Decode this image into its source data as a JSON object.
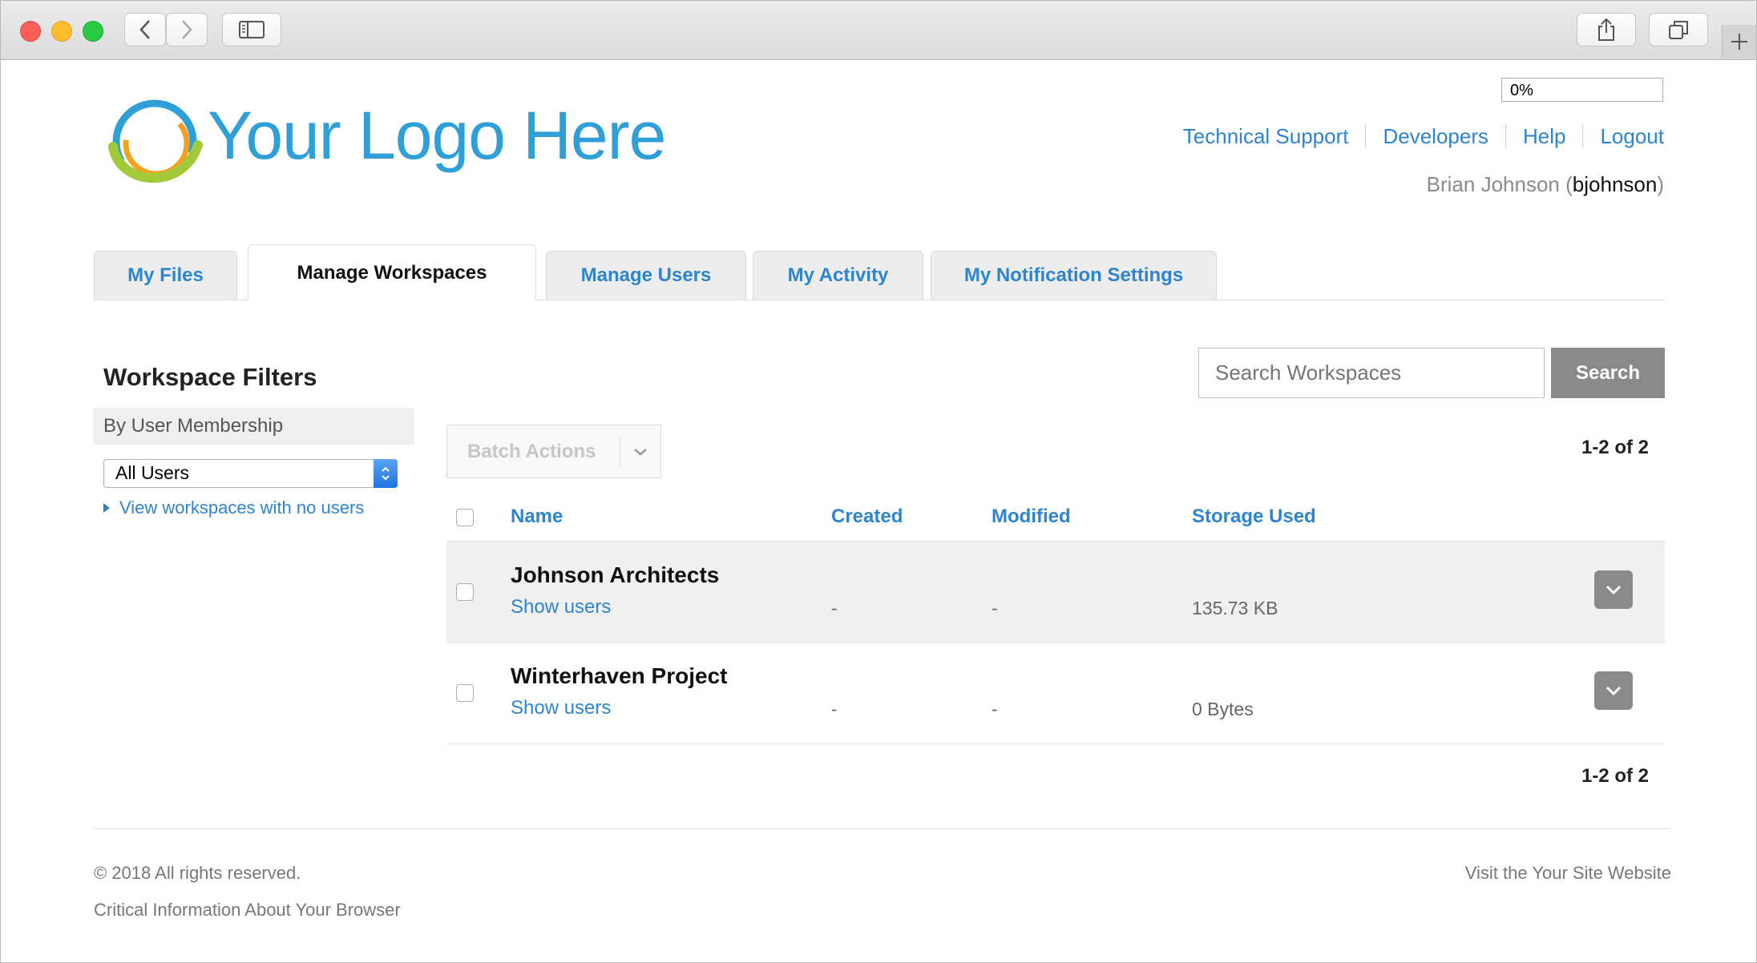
{
  "progress": {
    "text": "0%"
  },
  "logo": {
    "text": "Your Logo Here"
  },
  "header": {
    "links": [
      "Technical Support",
      "Developers",
      "Help",
      "Logout"
    ],
    "user": {
      "full_name": "Brian Johnson",
      "login": "bjohnson"
    }
  },
  "tabs": [
    {
      "label": "My Files",
      "active": false
    },
    {
      "label": "Manage Workspaces",
      "active": true
    },
    {
      "label": "Manage Users",
      "active": false
    },
    {
      "label": "My Activity",
      "active": false
    },
    {
      "label": "My Notification Settings",
      "active": false
    }
  ],
  "sidebar": {
    "title": "Workspace Filters",
    "membership_label": "By User Membership",
    "select_value": "All Users",
    "no_users_link": "View workspaces with no users"
  },
  "search": {
    "placeholder": "Search Workspaces",
    "button_label": "Search"
  },
  "batch": {
    "label": "Batch Actions"
  },
  "pagination": {
    "top": "1-2 of 2",
    "bottom": "1-2 of 2"
  },
  "table": {
    "headers": {
      "name": "Name",
      "created": "Created",
      "modified": "Modified",
      "storage": "Storage Used"
    },
    "rows": [
      {
        "name": "Johnson Architects",
        "show_users": "Show users",
        "created": "-",
        "modified": "-",
        "storage": "135.73 KB"
      },
      {
        "name": "Winterhaven Project",
        "show_users": "Show users",
        "created": "-",
        "modified": "-",
        "storage": "0 Bytes"
      }
    ]
  },
  "footer": {
    "copyright": "© 2018 All rights reserved.",
    "critical": "Critical Information About Your Browser",
    "visit": "Visit the Your Site Website"
  },
  "colors": {
    "link": "#2d84d0",
    "logo_text": "#2f9fd8",
    "button_gray": "#8a8a8a"
  }
}
